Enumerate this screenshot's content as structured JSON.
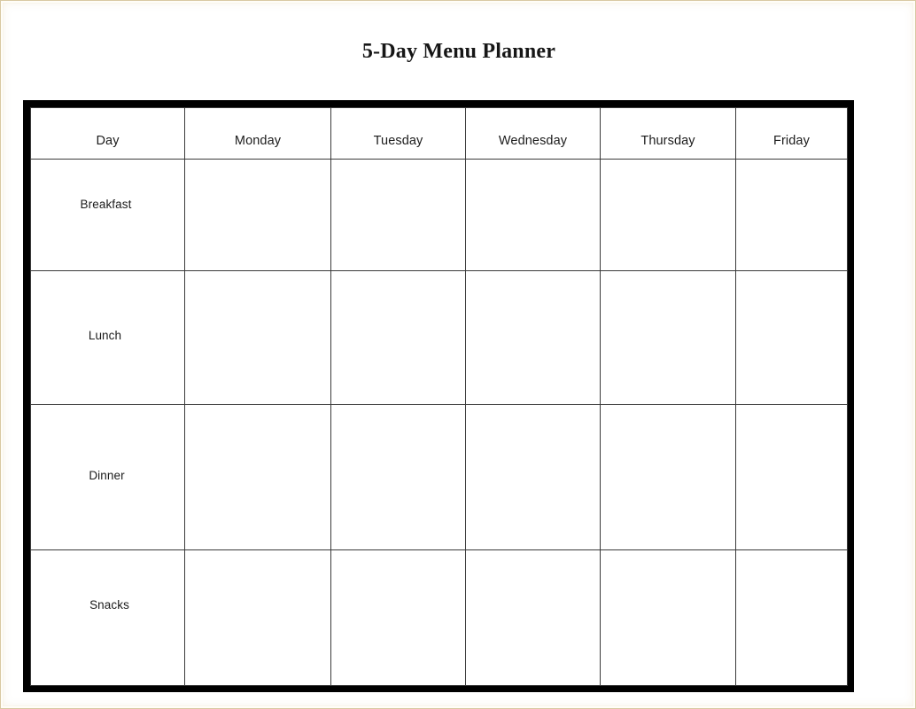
{
  "document": {
    "title": "5-Day Menu Planner"
  },
  "table": {
    "columns": [
      {
        "key": "day",
        "label": "Day"
      },
      {
        "key": "monday",
        "label": "Monday"
      },
      {
        "key": "tuesday",
        "label": "Tuesday"
      },
      {
        "key": "wednesday",
        "label": "Wednesday"
      },
      {
        "key": "thursday",
        "label": "Thursday"
      },
      {
        "key": "friday",
        "label": "Friday"
      }
    ],
    "rows": [
      {
        "key": "breakfast",
        "label": "Breakfast",
        "cells": [
          "",
          "",
          "",
          "",
          ""
        ]
      },
      {
        "key": "lunch",
        "label": "Lunch",
        "cells": [
          "",
          "",
          "",
          "",
          ""
        ]
      },
      {
        "key": "dinner",
        "label": "Dinner",
        "cells": [
          "",
          "",
          "",
          "",
          ""
        ]
      },
      {
        "key": "snacks",
        "label": "Snacks",
        "cells": [
          "",
          "",
          "",
          "",
          ""
        ]
      }
    ]
  },
  "colors": {
    "page_background": "#ffffff",
    "page_edge": "#d9c9a3",
    "table_border": "#000000",
    "grid_line": "#3a3a3a",
    "text": "#1b1b1b"
  }
}
